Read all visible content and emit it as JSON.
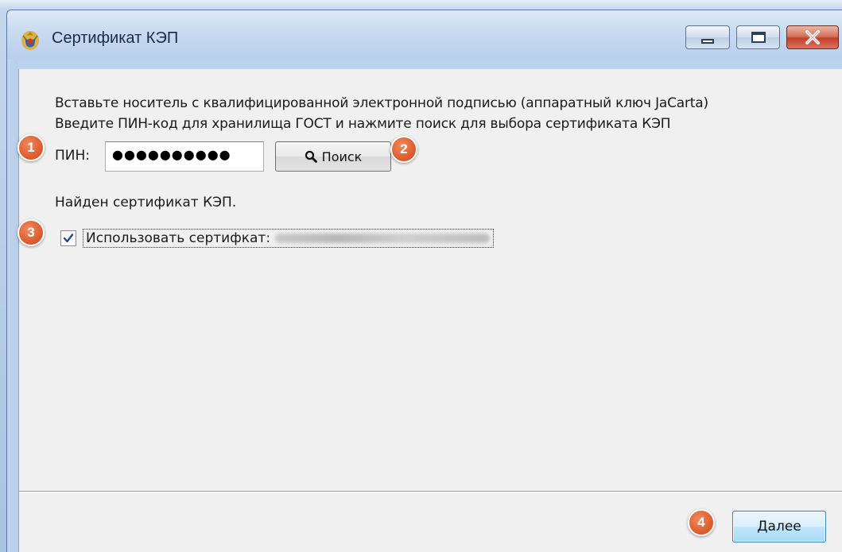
{
  "window": {
    "title": "Сертификат КЭП"
  },
  "content": {
    "instruction_line1": "Вставьте носитель с квалифицированной электронной подписью (аппаратный ключ JaCarta)",
    "instruction_line2": "Введите ПИН-код для хранилища ГОСТ и нажмите поиск для выбора сертификата КЭП",
    "pin_label": "ПИН:",
    "pin_value": "●●●●●●●●●●",
    "search_label": "Поиск",
    "found_text": "Найден сертификат КЭП.",
    "use_cert_label": "Использовать сертифкат:",
    "use_cert_checked": true
  },
  "footer": {
    "next_label": "Далее"
  },
  "callouts": [
    "1",
    "2",
    "3",
    "4"
  ],
  "colors": {
    "callout": "#dd5f30",
    "client_bg": "#f0f0f0",
    "frame": "#bcd3ee",
    "close_button": "#c2402a"
  },
  "icons": {
    "app": "emblem-icon",
    "search": "magnifier-icon",
    "checkbox": "check-icon"
  }
}
